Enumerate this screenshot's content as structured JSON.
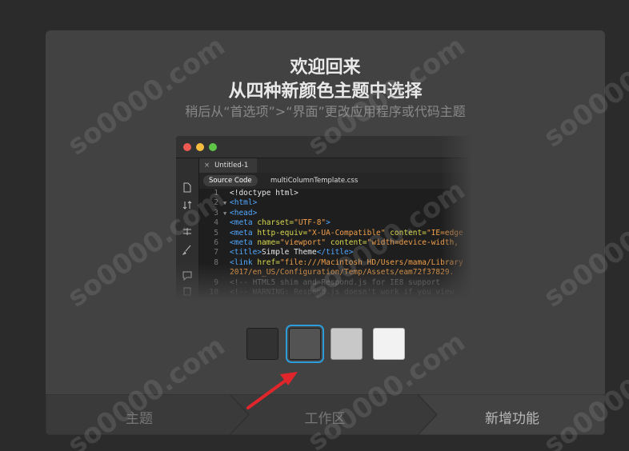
{
  "welcome": {
    "title": "欢迎回来",
    "heading": "从四种新颜色主题中选择",
    "subtitle": "稍后从“首选项”>“界面”更改应用程序或代码主题"
  },
  "editor": {
    "doc_tab": "Untitled-1",
    "close_glyph": "×",
    "subtabs": [
      "Source Code",
      "multiColumnTemplate.css"
    ],
    "code_lines": [
      {
        "n": "1",
        "fold": "",
        "segments": [
          {
            "t": "<!doctype html>",
            "c": "#e6e6e6"
          }
        ]
      },
      {
        "n": "2",
        "fold": "▼",
        "segments": [
          {
            "t": "<html>",
            "c": "#51a8ff"
          }
        ]
      },
      {
        "n": "3",
        "fold": "▼",
        "segments": [
          {
            "t": "<head>",
            "c": "#51a8ff"
          }
        ]
      },
      {
        "n": "4",
        "fold": "",
        "segments": [
          {
            "t": "<meta ",
            "c": "#51a8ff"
          },
          {
            "t": "charset=",
            "c": "#d9d94e"
          },
          {
            "t": "\"UTF-8\"",
            "c": "#f0a04b"
          },
          {
            "t": ">",
            "c": "#51a8ff"
          }
        ]
      },
      {
        "n": "5",
        "fold": "",
        "segments": [
          {
            "t": "<meta ",
            "c": "#51a8ff"
          },
          {
            "t": "http-equiv=",
            "c": "#d9d94e"
          },
          {
            "t": "\"X-UA-Compatible\"",
            "c": "#f0a04b"
          },
          {
            "t": " content=",
            "c": "#d9d94e"
          },
          {
            "t": "\"IE=edge",
            "c": "#f0a04b"
          }
        ]
      },
      {
        "n": "6",
        "fold": "",
        "segments": [
          {
            "t": "<meta ",
            "c": "#51a8ff"
          },
          {
            "t": "name=",
            "c": "#d9d94e"
          },
          {
            "t": "\"viewport\"",
            "c": "#f0a04b"
          },
          {
            "t": " content=",
            "c": "#d9d94e"
          },
          {
            "t": "\"width=device-width,",
            "c": "#f0a04b"
          }
        ]
      },
      {
        "n": "7",
        "fold": "",
        "segments": [
          {
            "t": "<title>",
            "c": "#51a8ff"
          },
          {
            "t": "Simple Theme",
            "c": "#e6e6e6"
          },
          {
            "t": "</title>",
            "c": "#51a8ff"
          }
        ]
      },
      {
        "n": "8",
        "fold": "",
        "segments": [
          {
            "t": "<link ",
            "c": "#51a8ff"
          },
          {
            "t": "href=",
            "c": "#d9d94e"
          },
          {
            "t": "\"file:///Macintosh HD/Users/mama/Library",
            "c": "#f0a04b"
          }
        ]
      },
      {
        "n": "",
        "fold": "",
        "segments": [
          {
            "t": "2017/en_US/Configuration/Temp/Assets/eam72f37829.",
            "c": "#f0a04b"
          }
        ]
      },
      {
        "n": "9",
        "fold": "",
        "segments": [
          {
            "t": "<!-- HTML5 shim and Respond.js for IE8 support",
            "c": "#7a7a7a"
          }
        ]
      },
      {
        "n": "10",
        "fold": "",
        "segments": [
          {
            "t": "<!-- WARNING: Respond.js doesn't work if you view",
            "c": "#7a7a7a"
          }
        ]
      }
    ]
  },
  "swatches": [
    {
      "name": "darkest",
      "color": "#323232"
    },
    {
      "name": "dark",
      "color": "#535353",
      "selected": true
    },
    {
      "name": "light",
      "color": "#c8c8c8"
    },
    {
      "name": "lightest",
      "color": "#f2f2f2"
    }
  ],
  "steps": [
    "主题",
    "工作区",
    "新增功能"
  ],
  "watermark": "so0000.com",
  "colors": {
    "accent": "#2d9cdb",
    "arrow": "#e0252b"
  }
}
